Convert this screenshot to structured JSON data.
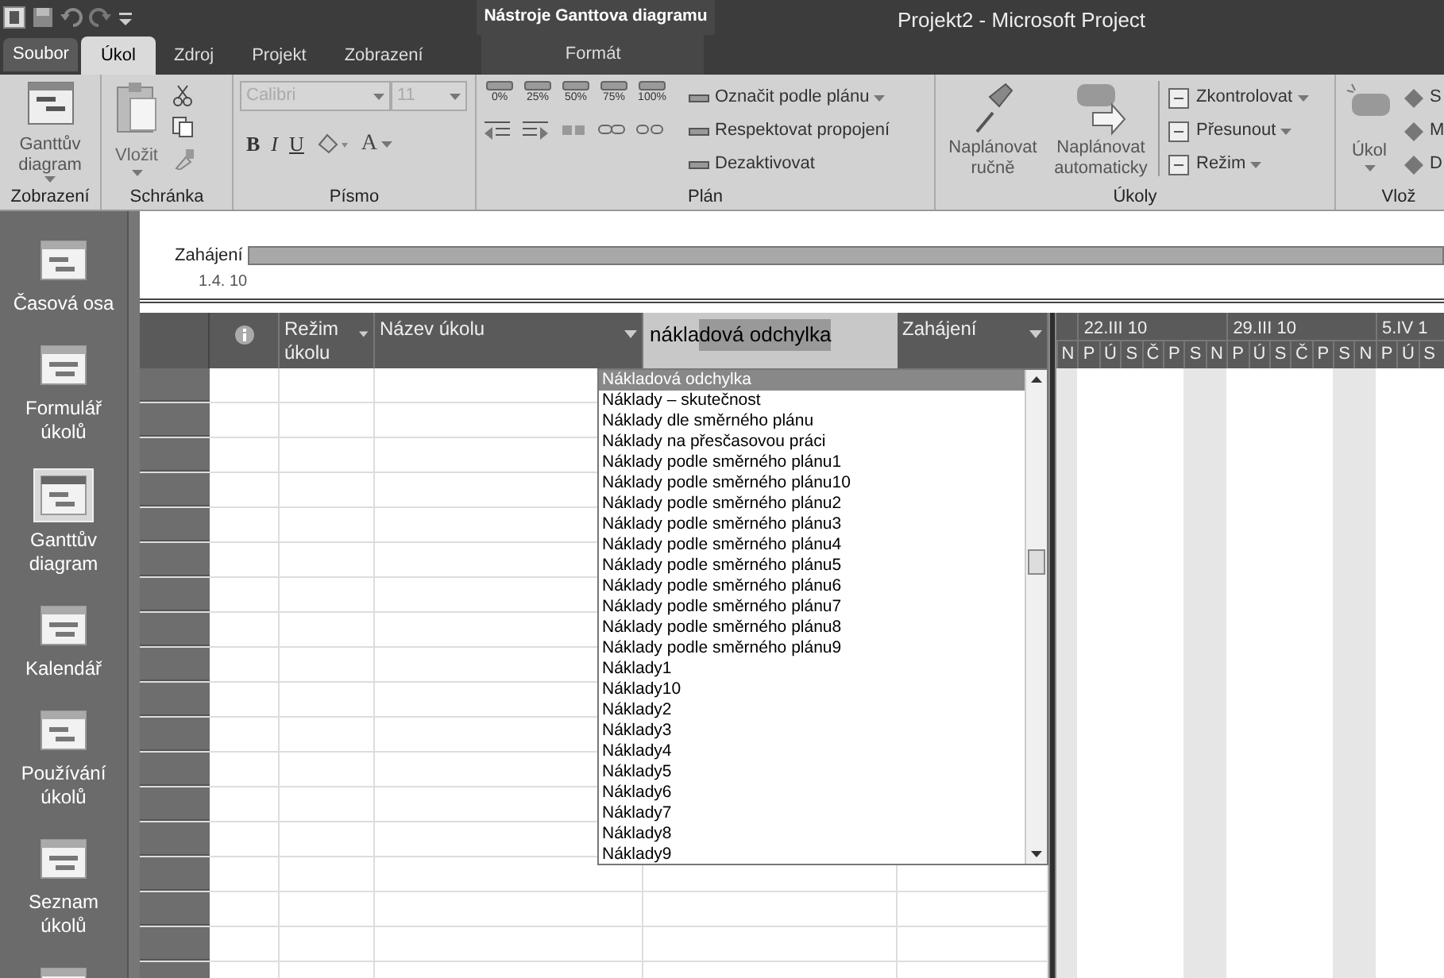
{
  "window": {
    "title": "Projekt2  -  Microsoft Project",
    "context_title": "Nástroje Ganttova diagramu"
  },
  "tabs": [
    {
      "label": "Soubor",
      "selected": false,
      "kind": "file"
    },
    {
      "label": "Úkol",
      "selected": true,
      "kind": "tab"
    },
    {
      "label": "Zdroj",
      "selected": false,
      "kind": "tab"
    },
    {
      "label": "Projekt",
      "selected": false,
      "kind": "tab"
    },
    {
      "label": "Zobrazení",
      "selected": false,
      "kind": "tab"
    },
    {
      "label": "Formát",
      "selected": false,
      "kind": "context"
    }
  ],
  "ribbon": [
    {
      "kind": "view",
      "label": "Zobrazení",
      "button": {
        "label": "Ganttův diagram",
        "dropdown": true
      }
    },
    {
      "kind": "clipboard",
      "label": "Schránka",
      "button": {
        "label": "Vložit",
        "dropdown": true
      }
    },
    {
      "kind": "font",
      "label": "Písmo",
      "font": {
        "value": "Calibri",
        "disabled": true
      },
      "size": {
        "value": "11",
        "disabled": true
      },
      "format_buttons": [
        "B",
        "I",
        "U"
      ],
      "color_button": "A"
    },
    {
      "kind": "schedule",
      "label": "Plán",
      "percent_buttons": [
        "0%",
        "25%",
        "50%",
        "75%",
        "100%"
      ],
      "commands": [
        {
          "label": "Označit podle plánu",
          "dropdown": true
        },
        {
          "label": "Respektovat propojení",
          "dropdown": false
        },
        {
          "label": "Dezaktivovat",
          "dropdown": false
        }
      ]
    },
    {
      "kind": "tasks",
      "label": "Úkoly",
      "large_buttons": [
        {
          "label": "Naplánovat ručně"
        },
        {
          "label": "Naplánovat automaticky"
        }
      ],
      "commands": [
        {
          "label": "Zkontrolovat",
          "dropdown": true
        },
        {
          "label": "Přesunout",
          "dropdown": true
        },
        {
          "label": "Režim",
          "dropdown": true
        }
      ]
    },
    {
      "kind": "insert",
      "label": "Vlož",
      "button": {
        "label": "Úkol",
        "dropdown": true
      },
      "commands": [
        {
          "label": "S"
        },
        {
          "label": "M"
        },
        {
          "label": "D"
        }
      ]
    }
  ],
  "sidebar": {
    "items": [
      {
        "label": "Časová osa",
        "selected": false
      },
      {
        "label": "Formulář úkolů",
        "selected": false
      },
      {
        "label": "Ganttův diagram",
        "selected": true
      },
      {
        "label": "Kalendář",
        "selected": false
      },
      {
        "label": "Používání úkolů",
        "selected": false
      },
      {
        "label": "Seznam úkolů",
        "selected": false
      },
      {
        "selected": false
      }
    ]
  },
  "timeline": {
    "start_label": "Zahájení",
    "start_date": "1.4. 10"
  },
  "table": {
    "columns": [
      {
        "kind": "info"
      },
      {
        "kind": "header",
        "label": "Režim úkolu",
        "filter": true
      },
      {
        "kind": "header",
        "label": "Název úkolu",
        "filter": true
      },
      {
        "kind": "edit",
        "typed": "nákla",
        "suggested": "dová odchylka"
      },
      {
        "kind": "header",
        "label": "Zahájení",
        "filter": true
      }
    ]
  },
  "dropdown": {
    "items": [
      {
        "label": "Nákladová odchylka",
        "selected": true
      },
      {
        "label": "Náklady – skutečnost",
        "selected": false
      },
      {
        "label": "Náklady dle směrného plánu",
        "selected": false
      },
      {
        "label": "Náklady na přesčasovou práci",
        "selected": false
      },
      {
        "label": "Náklady podle směrného plánu1",
        "selected": false
      },
      {
        "label": "Náklady podle směrného plánu10",
        "selected": false
      },
      {
        "label": "Náklady podle směrného plánu2",
        "selected": false
      },
      {
        "label": "Náklady podle směrného plánu3",
        "selected": false
      },
      {
        "label": "Náklady podle směrného plánu4",
        "selected": false
      },
      {
        "label": "Náklady podle směrného plánu5",
        "selected": false
      },
      {
        "label": "Náklady podle směrného plánu6",
        "selected": false
      },
      {
        "label": "Náklady podle směrného plánu7",
        "selected": false
      },
      {
        "label": "Náklady podle směrného plánu8",
        "selected": false
      },
      {
        "label": "Náklady podle směrného plánu9",
        "selected": false
      },
      {
        "label": "Náklady1",
        "selected": false
      },
      {
        "label": "Náklady10",
        "selected": false
      },
      {
        "label": "Náklady2",
        "selected": false
      },
      {
        "label": "Náklady3",
        "selected": false
      },
      {
        "label": "Náklady4",
        "selected": false
      },
      {
        "label": "Náklady5",
        "selected": false
      },
      {
        "label": "Náklady6",
        "selected": false
      },
      {
        "label": "Náklady7",
        "selected": false
      },
      {
        "label": "Náklady8",
        "selected": false
      },
      {
        "label": "Náklady9",
        "selected": false
      }
    ]
  },
  "gantt": {
    "weeks": [
      {
        "label": "22.III 10"
      },
      {
        "label": "29.III 10"
      },
      {
        "label": "5.IV 1"
      }
    ],
    "days": [
      {
        "label": "N",
        "weekend": true
      },
      {
        "label": "P",
        "weekend": false
      },
      {
        "label": "Ú",
        "weekend": false
      },
      {
        "label": "S",
        "weekend": false
      },
      {
        "label": "Č",
        "weekend": false
      },
      {
        "label": "P",
        "weekend": false
      },
      {
        "label": "S",
        "weekend": true
      },
      {
        "label": "N",
        "weekend": true
      },
      {
        "label": "P",
        "weekend": false
      },
      {
        "label": "Ú",
        "weekend": false
      },
      {
        "label": "S",
        "weekend": false
      },
      {
        "label": "Č",
        "weekend": false
      },
      {
        "label": "P",
        "weekend": false
      },
      {
        "label": "S",
        "weekend": true
      },
      {
        "label": "N",
        "weekend": true
      },
      {
        "label": "P",
        "weekend": false
      },
      {
        "label": "Ú",
        "weekend": false
      },
      {
        "label": "S",
        "weekend": false
      }
    ]
  }
}
